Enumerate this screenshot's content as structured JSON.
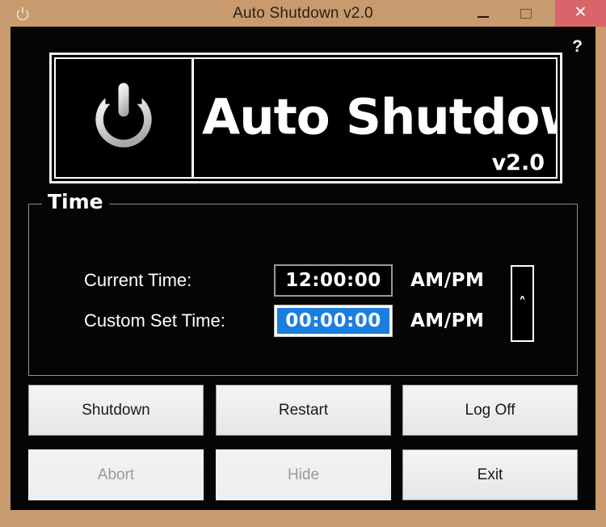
{
  "window": {
    "title": "Auto Shutdown v2.0",
    "app_icon": "power-icon",
    "frame_color": "#C89A6E",
    "client_color": "#050505",
    "controls": {
      "minimize_label": "—",
      "maximize_label": "□",
      "close_label": "✕",
      "close_color": "#D9656A"
    }
  },
  "help": {
    "label": "?"
  },
  "banner": {
    "logo_icon": "power-icon",
    "wordmark": "Auto Shutdown",
    "version": "v2.0"
  },
  "time_group": {
    "legend": "Time",
    "rows": [
      {
        "label": "Current Time:",
        "value": "12:00:00",
        "ampm": "AM/PM",
        "selected": false
      },
      {
        "label": "Custom Set Time:",
        "value": "00:00:00",
        "ampm": "AM/PM",
        "selected": true
      }
    ],
    "spinner": {
      "glyph": "˄",
      "name": "up-arrow"
    },
    "selection_color": "#1A7EE0"
  },
  "buttons": [
    {
      "label": "Shutdown",
      "enabled": true
    },
    {
      "label": "Restart",
      "enabled": true
    },
    {
      "label": "Log Off",
      "enabled": true
    },
    {
      "label": "Abort",
      "enabled": false
    },
    {
      "label": "Hide",
      "enabled": false
    },
    {
      "label": "Exit",
      "enabled": true
    }
  ]
}
